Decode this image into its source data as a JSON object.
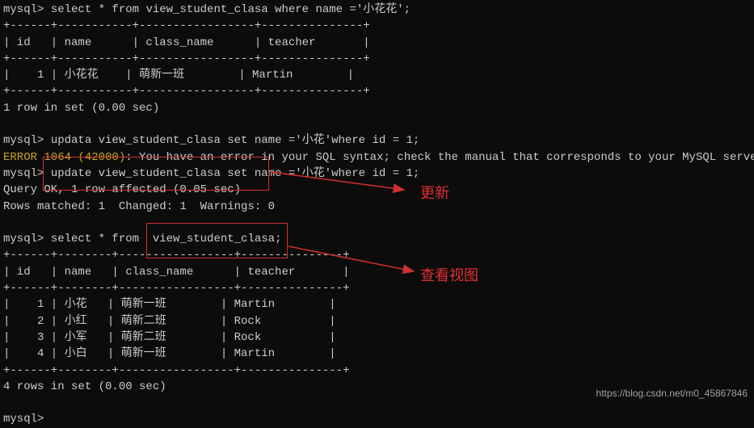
{
  "q1": {
    "prompt": "mysql>",
    "cmd": " select * from view_student_clasa where name ='小花花';",
    "border_top": "+------+-----------+-----------------+---------------+",
    "header": "| id   | name      | class_name      | teacher       |",
    "border_mid": "+------+-----------+-----------------+---------------+",
    "row1": "|    1 | 小花花    | 萌新一班        | Martin        |",
    "border_bot": "+------+-----------+-----------------+---------------+",
    "status": "1 row in set (0.00 sec)"
  },
  "q2": {
    "prompt": "mysql>",
    "cmd_wrong": " updata view_student_clasa set name ='小花'where id = 1;",
    "error_code": "ERROR 1064 (42000)",
    "error_tail": ": You have an error in your SQL syntax; check the manual that corresponds to your MySQL server v",
    "cmd_right": " update view_student_clasa set name ='小花'where id = 1;",
    "ok": "Query OK, 1 row affected (0.05 sec)",
    "matched": "Rows matched: 1  Changed: 1  Warnings: 0"
  },
  "q3": {
    "prompt": "mysql>",
    "cmd": " select * from  view_student_clasa;",
    "border_top": "+------+--------+-----------------+---------------+",
    "header": "| id   | name   | class_name      | teacher       |",
    "border_mid": "+------+--------+-----------------+---------------+",
    "row1": "|    1 | 小花   | 萌新一班        | Martin        |",
    "row2": "|    2 | 小红   | 萌新二班        | Rock          |",
    "row3": "|    3 | 小军   | 萌新二班        | Rock          |",
    "row4": "|    4 | 小白   | 萌新一班        | Martin        |",
    "border_bot": "+------+--------+-----------------+---------------+",
    "status": "4 rows in set (0.00 sec)"
  },
  "final_prompt": "mysql>",
  "annotations": {
    "update_label": "更新",
    "view_label": "查看视图"
  },
  "watermark": "https://blog.csdn.net/m0_45867846"
}
